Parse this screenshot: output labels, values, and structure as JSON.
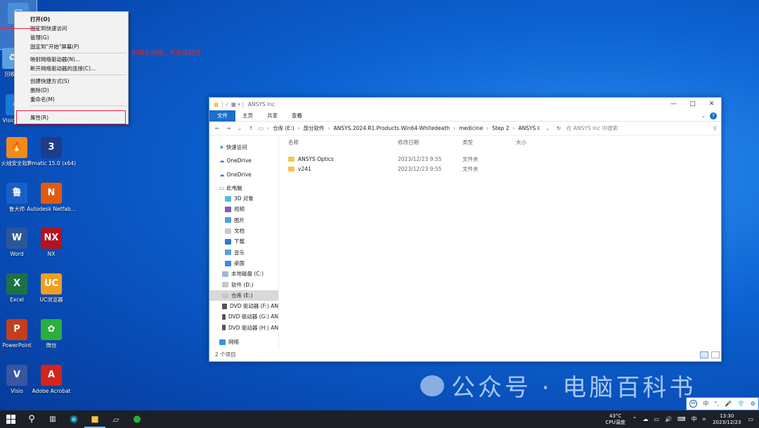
{
  "desktop_icons": [
    {
      "label": "此",
      "color": "#4a90d9",
      "glyph": "▢"
    },
    {
      "label": "回收站",
      "color": "#5aa0e0",
      "glyph": "♻"
    },
    {
      "label": "Visio Edge",
      "color": "#1c7ad6",
      "glyph": "e"
    },
    {
      "label": "火绒安全软件",
      "color": "#f08a1c",
      "glyph": "🔥"
    },
    {
      "label": "3-matic 15.0 (x64)",
      "color": "#1d3d8a",
      "glyph": "3"
    },
    {
      "label": "鲁大师",
      "color": "#1a5fc8",
      "glyph": "鲁"
    },
    {
      "label": "Autodesk Netfab...",
      "color": "#e05a10",
      "glyph": "N"
    },
    {
      "label": "Word",
      "color": "#2b579a",
      "glyph": "W"
    },
    {
      "label": "NX",
      "color": "#b3131e",
      "glyph": "NX"
    },
    {
      "label": "Excel",
      "color": "#1e7145",
      "glyph": "X"
    },
    {
      "label": "UC浏览器",
      "color": "#f0a020",
      "glyph": "UC"
    },
    {
      "label": "PowerPoint",
      "color": "#c43e1c",
      "glyph": "P"
    },
    {
      "label": "微信",
      "color": "#2aae3c",
      "glyph": "✿"
    },
    {
      "label": "Visio",
      "color": "#3955a3",
      "glyph": "V"
    },
    {
      "label": "Adobe Acrobat",
      "color": "#d4241b",
      "glyph": "A"
    }
  ],
  "context_menu": {
    "items": [
      "打开(O)",
      "固定到快速访问",
      "管理(G)",
      "固定到\"开始\"屏幕(P)",
      "映射网络驱动器(N)...",
      "断开网络驱动器的连接(C)...",
      "创建快捷方式(S)",
      "删除(D)",
      "重命名(M)"
    ],
    "properties": "属性(R)"
  },
  "annotation": "右键此电脑，并选择属性",
  "window": {
    "title": "ANSYS Inc",
    "tabs": [
      "文件",
      "主页",
      "共享",
      "查看"
    ],
    "breadcrumb": [
      "仓库 (E:)",
      "部分软件",
      "ANSYS.2024.R1.Products.Win64-Whitedeath",
      "medicine",
      "Step 2",
      "ANSYS Inc"
    ],
    "search_placeholder": "在 ANSYS Inc 中搜索",
    "nav": [
      "快速访问",
      "OneDrive",
      "OneDrive",
      "此电脑",
      "3D 对象",
      "视频",
      "图片",
      "文档",
      "下载",
      "音乐",
      "桌面",
      "本地磁盘 (C:)",
      "软件 (D:)",
      "仓库 (E:)",
      "DVD 驱动器 (F:) AN",
      "DVD 驱动器 (G:) AN",
      "DVD 驱动器 (H:) AN",
      "网络"
    ],
    "columns": [
      "名称",
      "修改日期",
      "类型",
      "大小"
    ],
    "files": [
      {
        "name": "ANSYS Optics",
        "date": "2023/12/23 9:55",
        "type": "文件夹",
        "size": ""
      },
      {
        "name": "v241",
        "date": "2023/12/23 9:55",
        "type": "文件夹",
        "size": ""
      }
    ],
    "status": "2 个项目"
  },
  "watermark": "公众号 · 电脑百科书",
  "ime": [
    "中",
    "°,",
    "🎤",
    "👕",
    "⚙"
  ],
  "taskbar": {
    "cpu_temp": "43°C",
    "cpu_label": "CPU温度",
    "lang": "中",
    "time": "13:30",
    "date": "2023/12/23"
  }
}
